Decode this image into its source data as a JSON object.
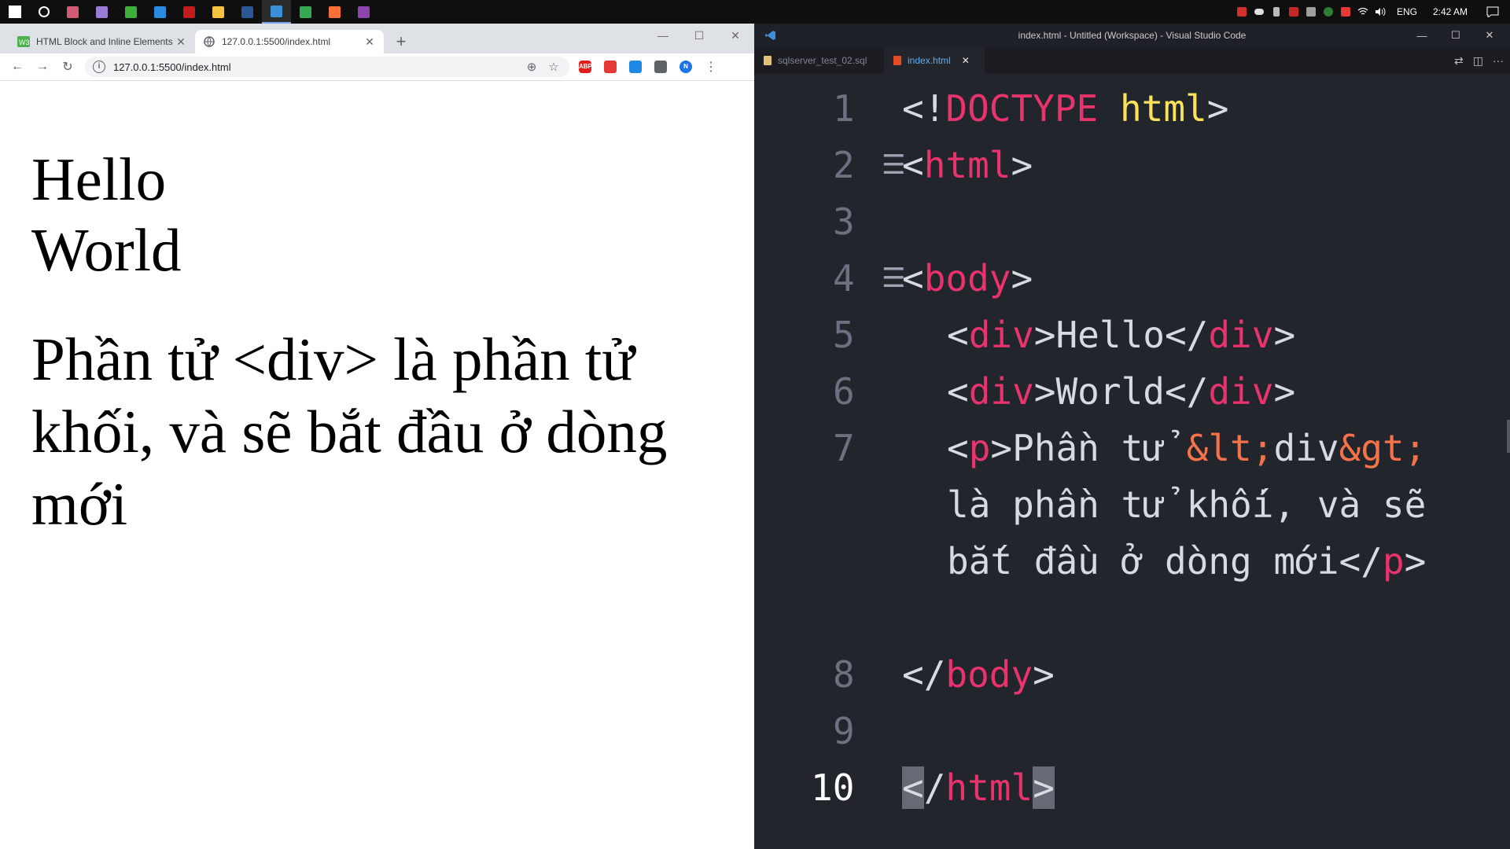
{
  "taskbar": {
    "apps": [
      "windows-start",
      "search",
      "task-view",
      "visual-studio",
      "app-green",
      "teamviewer",
      "app-red",
      "file-explorer",
      "word",
      "vscode",
      "chrome",
      "firefox",
      "winrar"
    ],
    "app_colors": [
      "#ffffff",
      "#ffffff",
      "#d45b75",
      "#9b7bd4",
      "#3cae3c",
      "#2b8ae2",
      "#c21c1c",
      "#f5c342",
      "#2b5797",
      "#3b8fd9",
      "#34a853",
      "#ff7139",
      "#8e44ad"
    ],
    "language": "ENG",
    "time": "2:42 AM"
  },
  "chrome": {
    "tabs": [
      {
        "title": "HTML Block and Inline Elements"
      },
      {
        "title": "127.0.0.1:5500/index.html"
      }
    ],
    "url": "127.0.0.1:5500/index.html",
    "extensions": [
      {
        "name": "adblock-plus",
        "label": "ABP",
        "color": "#e01d1d"
      },
      {
        "name": "pdf-extension",
        "label": "",
        "color": "#e53935"
      },
      {
        "name": "drop-extension",
        "label": "",
        "color": "#1e88e5"
      },
      {
        "name": "tools-extension",
        "label": "",
        "color": "#5f6368"
      },
      {
        "name": "profile",
        "label": "N",
        "color": "#1a73e8"
      }
    ],
    "page": {
      "div1": "Hello",
      "div2": "World",
      "p": "Phần tử <div> là phần tử khối, và sẽ bắt đầu ở dòng mới"
    }
  },
  "vscode": {
    "title": "index.html - Untitled (Workspace) - Visual Studio Code",
    "tabs": [
      {
        "label": "sqlserver_test_02.sql"
      },
      {
        "label": "index.html"
      }
    ],
    "line_numbers": [
      "1",
      "2",
      "3",
      "4",
      "5",
      "6",
      "7",
      "8",
      "9",
      "10"
    ],
    "code": {
      "l1_lt": "<!",
      "l1_doctype": "DOCTYPE",
      "l1_html": "html",
      "l1_gt": ">",
      "l2_lt": "<",
      "l2_tag": "html",
      "l2_gt": ">",
      "l4_lt": "<",
      "l4_tag": "body",
      "l4_gt": ">",
      "l5_lt1": "<",
      "l5_tag1": "div",
      "l5_text": ">Hello</",
      "l5_tag2": "div",
      "l5_gt": ">",
      "l6_lt1": "<",
      "l6_tag1": "div",
      "l6_text": ">World</",
      "l6_tag2": "div",
      "l6_gt": ">",
      "l7_lt": "<",
      "l7_tag": "p",
      "l7_text1": ">Phần tử ",
      "l7_ent1": "&lt;",
      "l7_text2": "div",
      "l7_ent2": "&gt;",
      "l7b_text": "là phần tử khối, và sẽ",
      "l7c_text": "bắt đầu ở dòng mới</",
      "l7c_tag": "p",
      "l7c_gt": ">",
      "l8_lt": "</",
      "l8_tag": "body",
      "l8_gt": ">",
      "l10_lt": "<",
      "l10_slash": "/",
      "l10_tag": "html",
      "l10_gt": ">"
    },
    "colors": {
      "tag": "#e8336c",
      "keyword": "#fbe25a",
      "entity": "#f6734a",
      "text": "#d7dae0"
    }
  }
}
